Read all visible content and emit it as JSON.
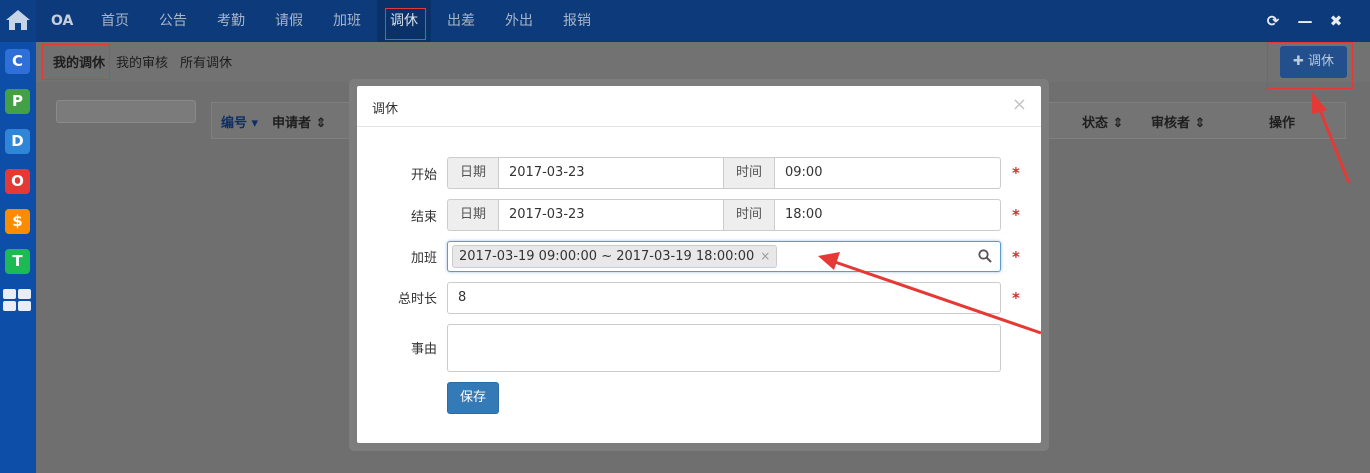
{
  "topbar": {
    "brand": "OA",
    "nav": [
      "首页",
      "公告",
      "考勤",
      "请假",
      "加班",
      "调休",
      "出差",
      "外出",
      "报销"
    ],
    "active": "调休",
    "window_controls": {
      "refresh": "C",
      "minimize": "—",
      "close": "✖"
    }
  },
  "dock": {
    "apps": [
      {
        "letter": "C",
        "color": "#2f6fd8"
      },
      {
        "letter": "P",
        "color": "#43a047"
      },
      {
        "letter": "D",
        "color": "#2f86d8"
      },
      {
        "letter": "O",
        "color": "#e53935"
      },
      {
        "letter": "$",
        "color": "#fb8c00"
      },
      {
        "letter": "T",
        "color": "#1db954"
      }
    ]
  },
  "subnav": {
    "tabs": [
      "我的调休",
      "我的审核",
      "所有调休"
    ],
    "active": "我的调休",
    "add_button": "✚ 调休"
  },
  "table": {
    "columns": [
      "编号",
      "申请者",
      "状态",
      "审核者",
      "操作"
    ]
  },
  "modal": {
    "title": "调休",
    "close": "×",
    "start": {
      "label": "开始",
      "date_addon": "日期",
      "date": "2017-03-23",
      "time_addon": "时间",
      "time": "09:00"
    },
    "end": {
      "label": "结束",
      "date_addon": "日期",
      "date": "2017-03-23",
      "time_addon": "时间",
      "time": "18:00"
    },
    "overtime": {
      "label": "加班",
      "selected": "2017-03-19 09:00:00 ~ 2017-03-19 18:00:00",
      "remove": "×"
    },
    "duration": {
      "label": "总时长",
      "value": "8"
    },
    "reason": {
      "label": "事由",
      "value": ""
    },
    "required_mark": "*",
    "save": "保存"
  },
  "colors": {
    "accent": "#337ab7",
    "annotation": "#e53935",
    "required": "#d32f2f"
  }
}
